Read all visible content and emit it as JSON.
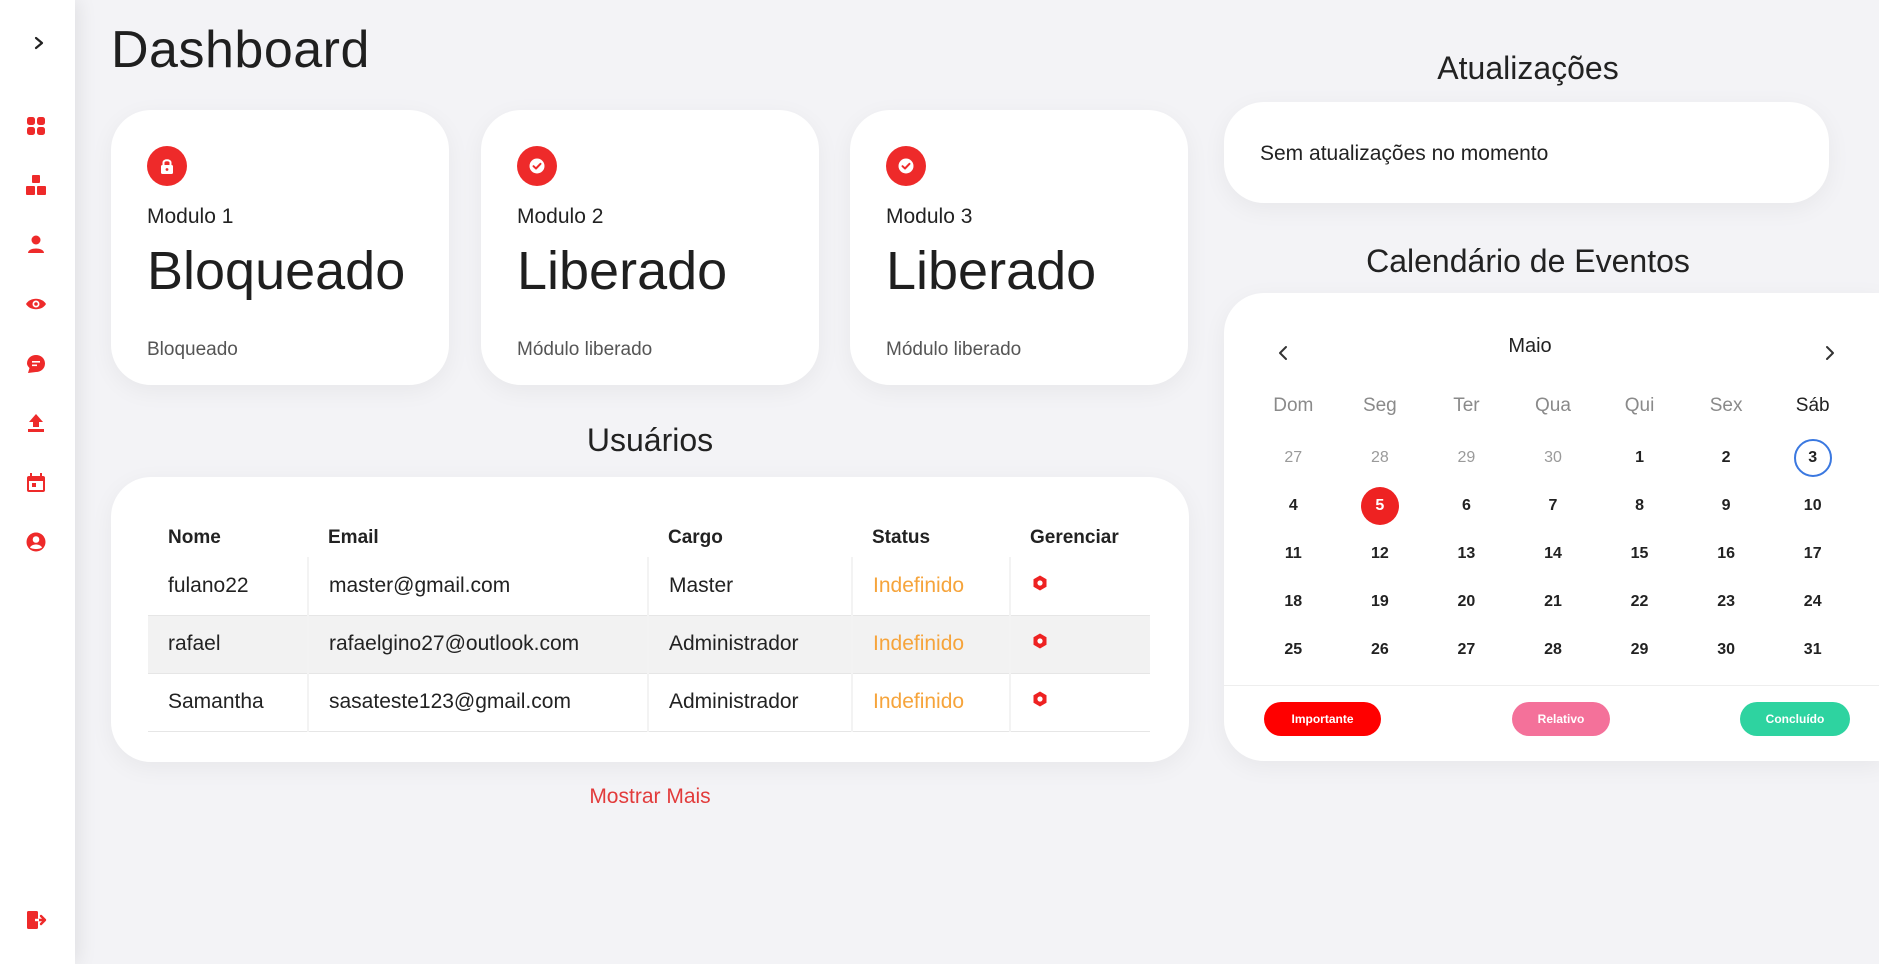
{
  "sidebar": {
    "toggle_icon": "chevron-right-icon",
    "items": [
      {
        "name": "grid-icon"
      },
      {
        "name": "blocks-icon"
      },
      {
        "name": "user-icon"
      },
      {
        "name": "eye-icon"
      },
      {
        "name": "chat-icon"
      },
      {
        "name": "upload-icon"
      },
      {
        "name": "calendar-icon"
      },
      {
        "name": "account-circle-icon"
      }
    ],
    "logout_icon": "logout-icon",
    "accent": "#ee2a2a"
  },
  "header": {
    "title": "Dashboard"
  },
  "modules": [
    {
      "name": "Modulo 1",
      "status": "Bloqueado",
      "description": "Bloqueado",
      "icon": "lock-icon"
    },
    {
      "name": "Modulo 2",
      "status": "Liberado",
      "description": "Módulo liberado",
      "icon": "check-circle-icon"
    },
    {
      "name": "Modulo 3",
      "status": "Liberado",
      "description": "Módulo liberado",
      "icon": "check-circle-icon"
    }
  ],
  "users": {
    "title": "Usuários",
    "columns": [
      "Nome",
      "Email",
      "Cargo",
      "Status",
      "Gerenciar"
    ],
    "rows": [
      {
        "name": "fulano22",
        "email": "master@gmail.com",
        "role": "Master",
        "status": "Indefinido"
      },
      {
        "name": "rafael",
        "email": "rafaelgino27@outlook.com",
        "role": "Administrador",
        "status": "Indefinido"
      },
      {
        "name": "Samantha",
        "email": "sasateste123@gmail.com",
        "role": "Administrador",
        "status": "Indefinido"
      }
    ],
    "status_color": "#f6a43b",
    "show_more": "Mostrar Mais"
  },
  "updates": {
    "title": "Atualizações",
    "message": "Sem atualizações no momento"
  },
  "calendar": {
    "title": "Calendário de Eventos",
    "month": "Maio",
    "weekdays": [
      "Dom",
      "Seg",
      "Ter",
      "Qua",
      "Qui",
      "Sex",
      "Sáb"
    ],
    "weeks": [
      [
        "27",
        "28",
        "29",
        "30",
        "1",
        "2",
        "3"
      ],
      [
        "4",
        "5",
        "6",
        "7",
        "8",
        "9",
        "10"
      ],
      [
        "11",
        "12",
        "13",
        "14",
        "15",
        "16",
        "17"
      ],
      [
        "18",
        "19",
        "20",
        "21",
        "22",
        "23",
        "24"
      ],
      [
        "25",
        "26",
        "27",
        "28",
        "29",
        "30",
        "31"
      ]
    ],
    "muted_first_week_count": 4,
    "today": "5",
    "selected": "3",
    "legend": [
      {
        "label": "Importante",
        "color": "#ff0000"
      },
      {
        "label": "Relativo",
        "color": "#f4719a"
      },
      {
        "label": "Concluído",
        "color": "#2ed3a0"
      }
    ]
  }
}
